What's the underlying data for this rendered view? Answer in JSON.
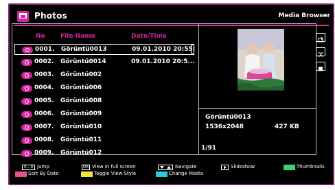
{
  "header": {
    "title": "Photos",
    "right_label": "Media Browser"
  },
  "columns": {
    "no": "No",
    "file_name": "File Name",
    "date_time": "Date/Time"
  },
  "files": [
    {
      "no": "0001.",
      "name": "Görüntü0013",
      "date": "09.01.2010 20:55:"
    },
    {
      "no": "0002.",
      "name": "Görüntü0014",
      "date": "09.01.2010 20:5..."
    },
    {
      "no": "0003.",
      "name": "Görüntü002",
      "date": ""
    },
    {
      "no": "0004.",
      "name": "Görüntü006",
      "date": ""
    },
    {
      "no": "0005.",
      "name": "Görüntü008",
      "date": ""
    },
    {
      "no": "0006.",
      "name": "Görüntü009",
      "date": ""
    },
    {
      "no": "0007.",
      "name": "Görüntü010",
      "date": ""
    },
    {
      "no": "0008.",
      "name": "Görüntü011",
      "date": ""
    },
    {
      "no": "0009.",
      "name": "Görüntü012",
      "date": ""
    }
  ],
  "preview": {
    "name": "Görüntü0013",
    "resolution": "1536x2048",
    "size": "427 KB",
    "position": "1/91"
  },
  "legend": {
    "jump_key": "0...9",
    "jump": "Jump",
    "ok_key": "OK",
    "fullscreen": "View in full screen",
    "navigate": "Navigate",
    "slideshow": "Slideshow",
    "thumbnails": "Thumbnails",
    "sort_date": "Sort By Date",
    "toggle_view": "Toggle View Style",
    "change_media": "Change Media"
  },
  "colors": {
    "accent": "#d2269d",
    "red": "#e8508f",
    "yellow": "#f2e23a",
    "cyan": "#2ec8e0",
    "green": "#3bd07a"
  }
}
